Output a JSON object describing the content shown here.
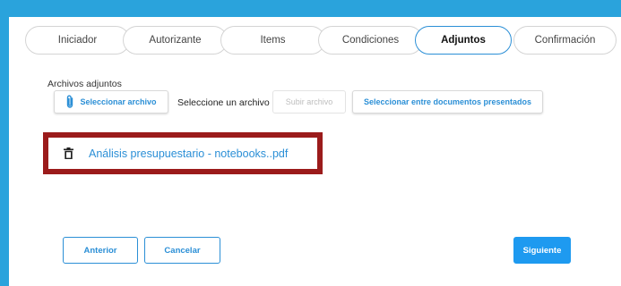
{
  "colors": {
    "background": "#2aa3dc",
    "accent": "#2b8fd6",
    "primary_button": "#1e9af0",
    "highlight_border": "#9b1b1b"
  },
  "tabs": [
    {
      "label": "Iniciador",
      "active": false
    },
    {
      "label": "Autorizante",
      "active": false
    },
    {
      "label": "Items",
      "active": false
    },
    {
      "label": "Condiciones",
      "active": false
    },
    {
      "label": "Adjuntos",
      "active": true
    },
    {
      "label": "Confirmación",
      "active": false
    }
  ],
  "attachments": {
    "section_label": "Archivos adjuntos",
    "select_file_label": "Seleccionar archivo",
    "select_file_icon": "paperclip-icon",
    "file_status": "Seleccione un archivo",
    "upload_label": "Subir archivo",
    "select_docs_label": "Seleccionar entre documentos presentados",
    "files": [
      {
        "name": "Análisis presupuestario - notebooks..pdf",
        "icon": "trash-icon"
      }
    ]
  },
  "footer": {
    "prev_label": "Anterior",
    "cancel_label": "Cancelar",
    "next_label": "Siguiente"
  }
}
